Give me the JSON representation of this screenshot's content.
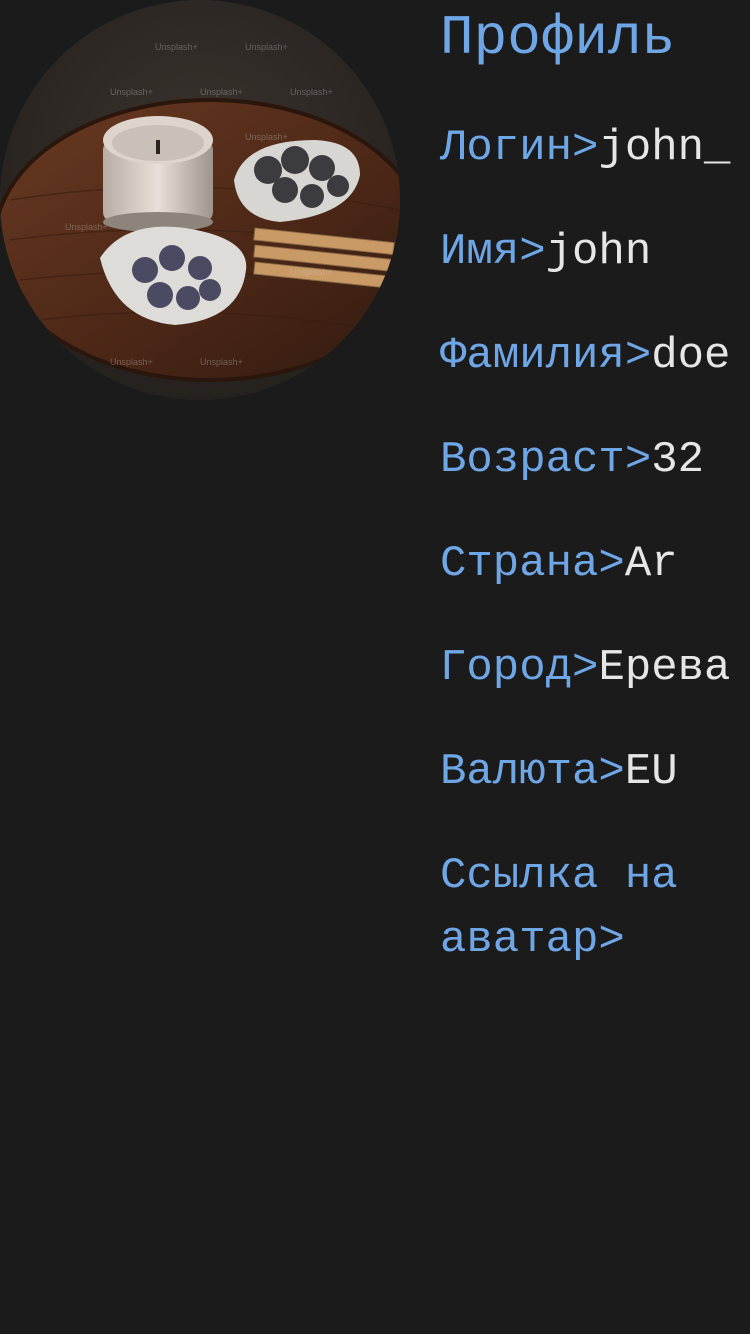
{
  "title": "Профиль",
  "colors": {
    "background": "#1b1b1c",
    "label": "#6fa6e6",
    "value": "#e6e6e6"
  },
  "avatar": {
    "watermark": "Unsplash+"
  },
  "fields": [
    {
      "label": "Логин>",
      "value": "john_"
    },
    {
      "label": "Имя>",
      "value": "john"
    },
    {
      "label": "Фамилия>",
      "value": "doe"
    },
    {
      "label": "Возраст>",
      "value": "32"
    },
    {
      "label": "Страна>",
      "value": "Ar"
    },
    {
      "label": "Город>",
      "value": "Ерева"
    },
    {
      "label": "Валюта>",
      "value": "EU"
    },
    {
      "label": "Ссылка на аватар>",
      "value": ""
    }
  ]
}
